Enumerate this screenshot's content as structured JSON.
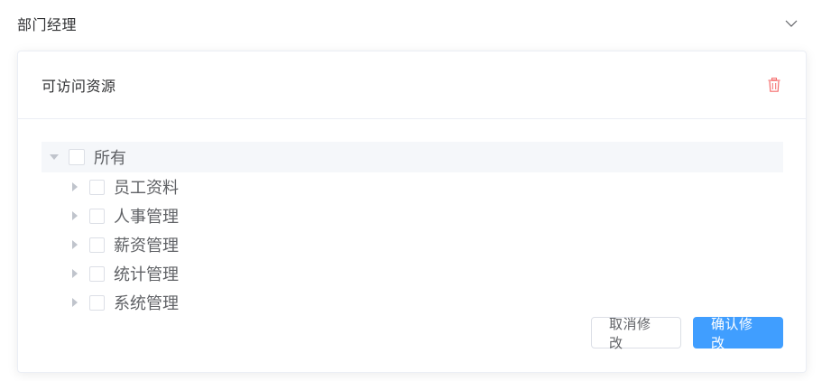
{
  "collapse": {
    "title": "部门经理",
    "chevron_icon": "chevron-down-icon"
  },
  "card": {
    "title": "可访问资源",
    "delete_icon": "trash-icon",
    "delete_color": "#f56c6c"
  },
  "tree": {
    "root": {
      "label": "所有",
      "checked": false,
      "expanded": true
    },
    "children": [
      {
        "label": "员工资料",
        "checked": false,
        "expanded": false
      },
      {
        "label": "人事管理",
        "checked": false,
        "expanded": false
      },
      {
        "label": "薪资管理",
        "checked": false,
        "expanded": false
      },
      {
        "label": "统计管理",
        "checked": false,
        "expanded": false
      },
      {
        "label": "系统管理",
        "checked": false,
        "expanded": false
      }
    ]
  },
  "actions": {
    "cancel_label": "取消修改",
    "confirm_label": "确认修改",
    "accent": "#409eff"
  }
}
